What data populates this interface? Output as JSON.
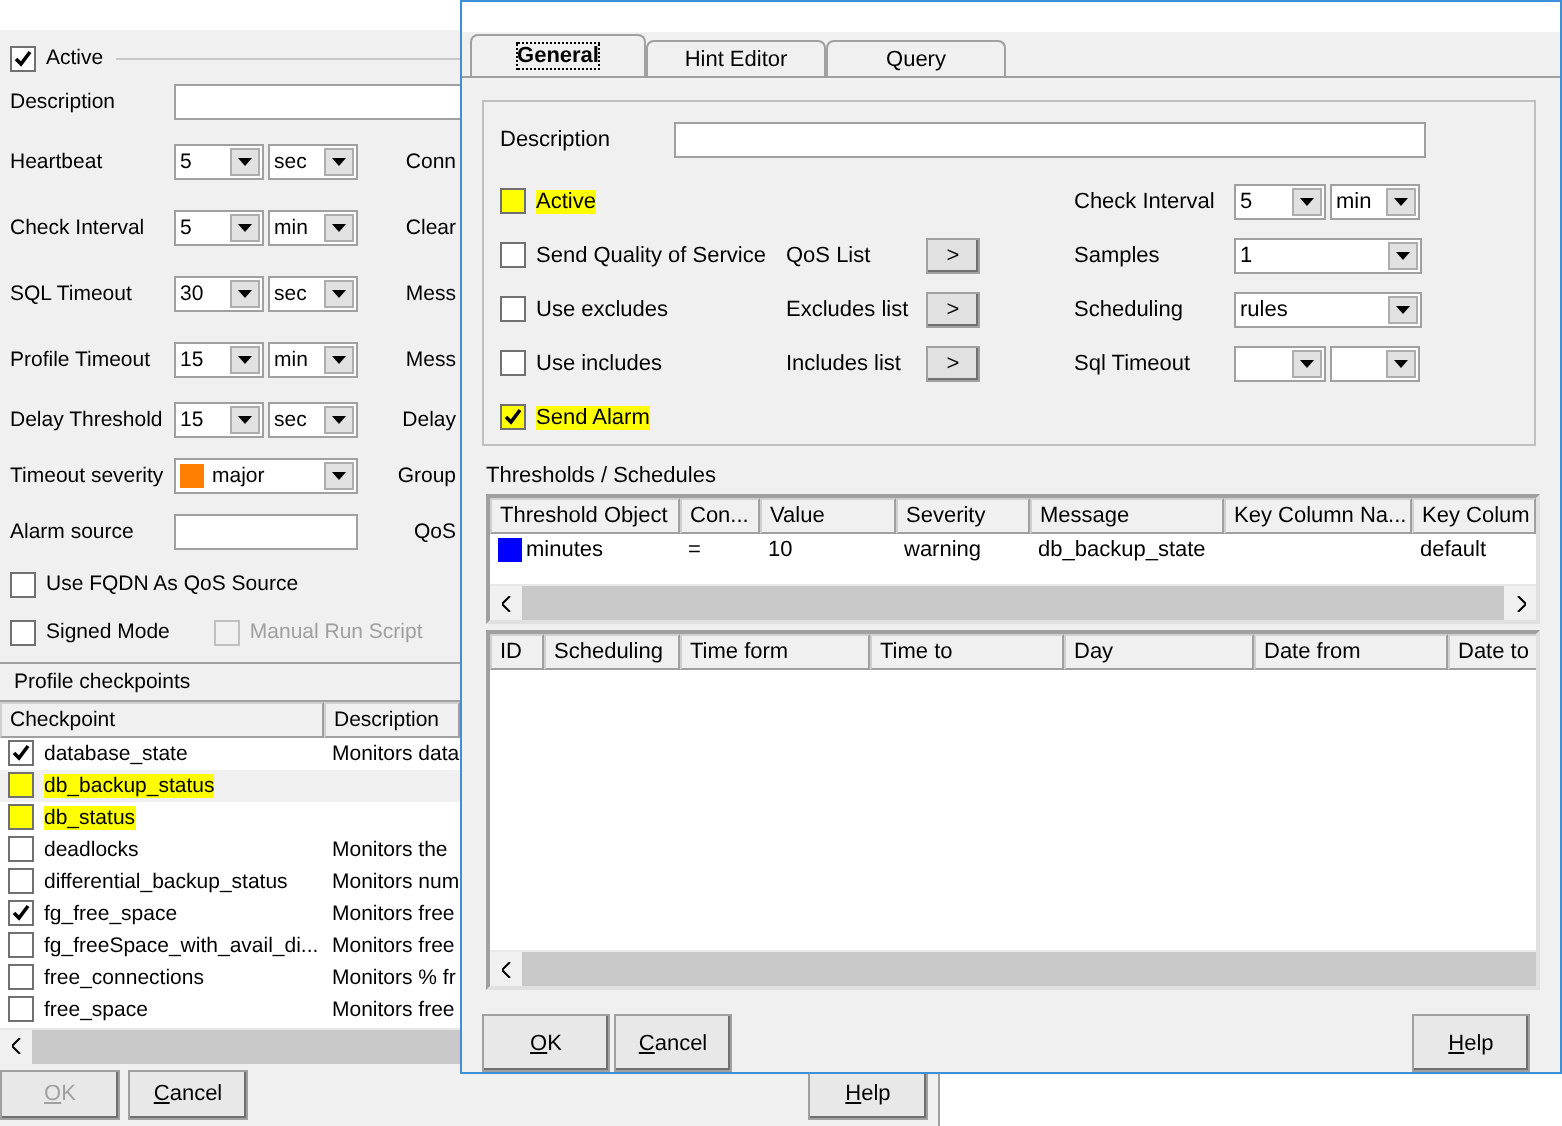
{
  "left_window": {
    "active": {
      "label": "Active",
      "checked": true
    },
    "description_label": "Description",
    "fields": [
      {
        "label": "Heartbeat",
        "kind": "interval",
        "value": "5",
        "unit": "sec",
        "side_label": "Conn"
      },
      {
        "label": "Check Interval",
        "kind": "interval",
        "value": "5",
        "unit": "min",
        "side_label": "Clear"
      },
      {
        "label": "SQL Timeout",
        "kind": "interval",
        "value": "30",
        "unit": "sec",
        "side_label": "Mess"
      },
      {
        "label": "Profile Timeout",
        "kind": "interval",
        "value": "15",
        "unit": "min",
        "side_label": "Mess"
      },
      {
        "label": "Delay Threshold",
        "kind": "interval",
        "value": "15",
        "unit": "sec",
        "side_label": "Delay"
      },
      {
        "label": "Timeout severity",
        "kind": "severity",
        "value": "major",
        "color": "#ff8000",
        "side_label": "Group"
      },
      {
        "label": "Alarm source",
        "kind": "text",
        "side_label": "QoS"
      }
    ],
    "option_rows": [
      [
        {
          "label": "Use FQDN As QoS Source",
          "checked": false,
          "disabled": false
        }
      ],
      [
        {
          "label": "Signed Mode",
          "checked": false,
          "disabled": false
        },
        {
          "label": "Manual Run Script",
          "checked": false,
          "disabled": true
        }
      ]
    ],
    "section_title": "Profile checkpoints",
    "checkpoints": {
      "columns": [
        "Checkpoint",
        "Description"
      ],
      "rows": [
        {
          "name": "database_state",
          "description": "Monitors data",
          "checked": true,
          "selected": false,
          "highlighted": false
        },
        {
          "name": "db_backup_status",
          "checked": false,
          "selected": true,
          "highlighted": true
        },
        {
          "name": "db_status",
          "checked": false,
          "selected": false,
          "highlighted": true
        },
        {
          "name": "deadlocks",
          "description": "Monitors the",
          "checked": false,
          "selected": false,
          "highlighted": false
        },
        {
          "name": "differential_backup_status",
          "description": "Monitors num",
          "checked": false,
          "selected": false,
          "highlighted": false
        },
        {
          "name": "fg_free_space",
          "description": "Monitors free",
          "checked": true,
          "selected": false,
          "highlighted": false
        },
        {
          "name": "fg_freeSpace_with_avail_di...",
          "description": "Monitors free",
          "checked": false,
          "selected": false,
          "highlighted": false
        },
        {
          "name": "free_connections",
          "description": "Monitors % fr",
          "checked": false,
          "selected": false,
          "highlighted": false
        },
        {
          "name": "free_space",
          "description": "Monitors free",
          "checked": false,
          "selected": false,
          "highlighted": false
        }
      ]
    },
    "buttons": [
      {
        "label": "OK",
        "disabled": true
      },
      {
        "label": "Cancel",
        "disabled": false
      },
      {
        "label": "Help",
        "disabled": false
      }
    ]
  },
  "dialog": {
    "tabs": [
      {
        "label": "General",
        "selected": true
      },
      {
        "label": "Hint Editor",
        "selected": false
      },
      {
        "label": "Query",
        "selected": false
      }
    ],
    "description_label": "Description",
    "checkboxes": [
      {
        "label": "Active",
        "checked": false,
        "highlighted": true
      },
      {
        "label": "Send Quality of Service",
        "checked": false,
        "highlighted": false
      },
      {
        "label": "Use excludes",
        "checked": false,
        "highlighted": false
      },
      {
        "label": "Use includes",
        "checked": false,
        "highlighted": false
      },
      {
        "label": "Send Alarm",
        "checked": true,
        "highlighted": true
      }
    ],
    "list_buttons": [
      {
        "label": "QoS List",
        "button": ">"
      },
      {
        "label": "Excludes list",
        "button": ">"
      },
      {
        "label": "Includes list",
        "button": ">"
      }
    ],
    "settings": [
      {
        "label": "Check Interval",
        "kind": "interval",
        "value": "5",
        "unit": "min"
      },
      {
        "label": "Samples",
        "kind": "single",
        "value": "1"
      },
      {
        "label": "Scheduling",
        "kind": "single",
        "value": "rules"
      },
      {
        "label": "Sql Timeout",
        "kind": "interval"
      }
    ],
    "thresholds_title": "Thresholds / Schedules",
    "thresholds": {
      "columns": [
        "Threshold Object",
        "Con...",
        "Value",
        "Severity",
        "Message",
        "Key Column Na...",
        "Key Colum"
      ],
      "rows": [
        {
          "color": "#0000ff",
          "cells": [
            "minutes",
            "=",
            "10",
            "warning",
            "db_backup_state",
            "",
            "default"
          ]
        }
      ]
    },
    "schedules": {
      "columns": [
        "ID",
        "Scheduling",
        "Time form",
        "Time to",
        "Day",
        "Date from",
        "Date to"
      ]
    },
    "buttons": [
      {
        "label": "OK"
      },
      {
        "label": "Cancel"
      },
      {
        "label": "Help"
      }
    ]
  }
}
